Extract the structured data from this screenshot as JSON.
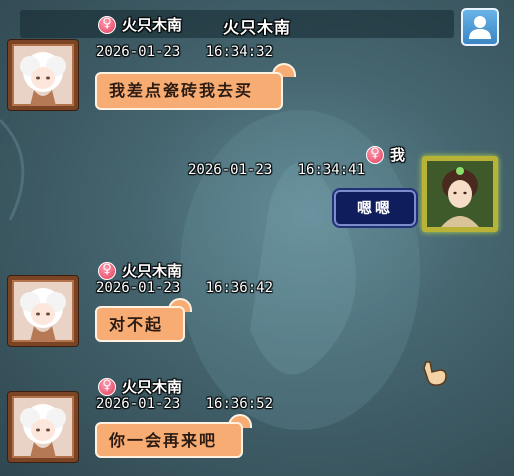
{
  "header": {
    "title": "火只木南",
    "profile_icon": "user-icon"
  },
  "colors": {
    "bubble": "#f7ac74",
    "bubble_self": "#0f1d5c",
    "gender_female": "#e23c5b"
  },
  "messages": [
    {
      "sender": "火只木南",
      "gender": "female",
      "date": "2026-01-23",
      "time": "16:34:32",
      "text": "我差点瓷砖我去买",
      "side": "left"
    },
    {
      "sender": "我",
      "gender": "female",
      "date": "2026-01-23",
      "time": "16:34:41",
      "text": "嗯嗯",
      "side": "right"
    },
    {
      "sender": "火只木南",
      "gender": "female",
      "date": "2026-01-23",
      "time": "16:36:42",
      "text": "对不起",
      "side": "left"
    },
    {
      "sender": "火只木南",
      "gender": "female",
      "date": "2026-01-23",
      "time": "16:36:52",
      "text": "你一会再来吧",
      "side": "left"
    }
  ]
}
